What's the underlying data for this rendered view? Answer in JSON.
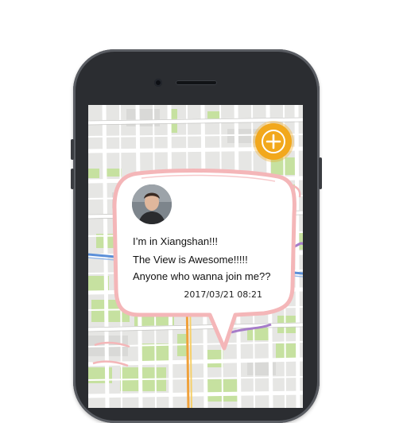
{
  "screen": {
    "map_view": "city street map"
  },
  "fab": {
    "icon": "plus-icon",
    "color": "#f2a81c"
  },
  "post": {
    "avatar": "user-avatar",
    "lines": [
      "I’m in Xiangshan!!!",
      "The View is Awesome!!!!!",
      "Anyone who wanna join me??"
    ],
    "timestamp": "2017/03/21 08:21",
    "border_color": "#f4b6b8"
  }
}
